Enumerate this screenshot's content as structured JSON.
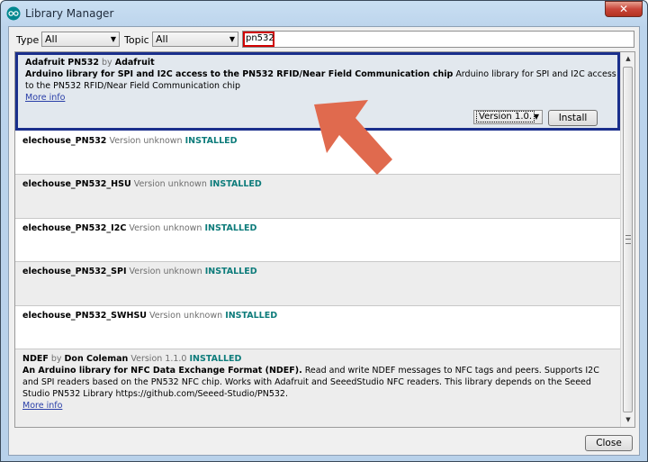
{
  "window": {
    "title": "Library Manager",
    "close_glyph": "✕",
    "app_icon": "arduino-logo-icon"
  },
  "filters": {
    "type_label": "Type",
    "type_value": "All",
    "topic_label": "Topic",
    "topic_value": "All",
    "search_value": "pn532"
  },
  "libraries": [
    {
      "name": "Adafruit PN532",
      "by": "by",
      "author": "Adafruit",
      "version": "",
      "status": "",
      "sentence": "Arduino library for SPI and I2C access to the PN532 RFID/Near Field Communication chip",
      "paragraph": "Arduino library for SPI and I2C access to the PN532 RFID/Near Field Communication chip",
      "more_info": "More info",
      "version_select": "Version 1.0.",
      "install_label": "Install"
    },
    {
      "name": "elechouse_PN532",
      "version": "Version unknown",
      "status": "INSTALLED"
    },
    {
      "name": "elechouse_PN532_HSU",
      "version": "Version unknown",
      "status": "INSTALLED"
    },
    {
      "name": "elechouse_PN532_I2C",
      "version": "Version unknown",
      "status": "INSTALLED"
    },
    {
      "name": "elechouse_PN532_SPI",
      "version": "Version unknown",
      "status": "INSTALLED"
    },
    {
      "name": "elechouse_PN532_SWHSU",
      "version": "Version unknown",
      "status": "INSTALLED"
    },
    {
      "name": "NDEF",
      "by": "by",
      "author": "Don Coleman",
      "version": "Version 1.1.0",
      "status": "INSTALLED",
      "sentence": "An Arduino library for NFC Data Exchange Format (NDEF).",
      "paragraph": "Read and write NDEF messages to NFC tags and peers. Supports I2C and SPI readers based on the PN532 NFC chip. Works with Adafruit and SeeedStudio NFC readers. This library depends on the Seeed Studio PN532 Library https://github.com/Seeed-Studio/PN532.",
      "more_info": "More info"
    }
  ],
  "footer": {
    "close_label": "Close"
  },
  "annotation": {
    "highlight_color": "#d00000",
    "arrow_color": "#e06a4e",
    "selection_color": "#1a2f8c"
  }
}
